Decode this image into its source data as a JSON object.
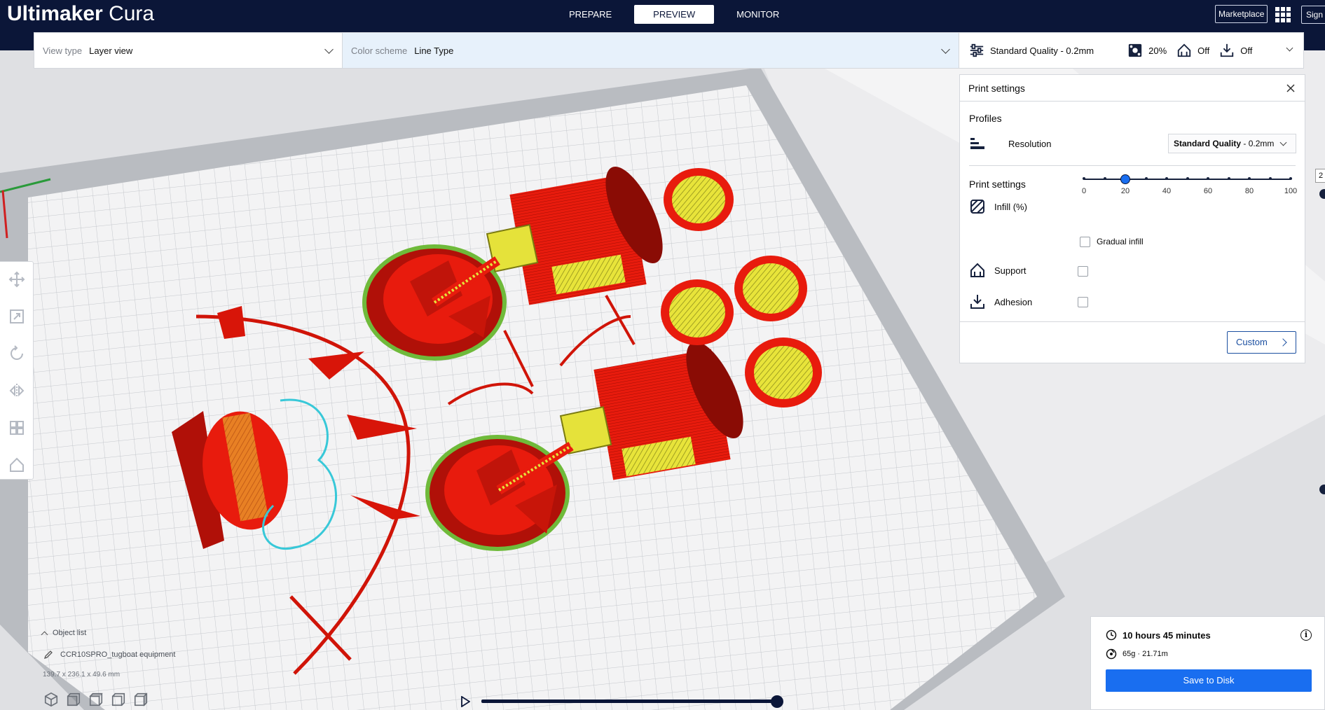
{
  "app": {
    "title_bold": "Ultimaker",
    "title_light": "Cura"
  },
  "stages": [
    "PREPARE",
    "PREVIEW",
    "MONITOR"
  ],
  "header": {
    "marketplace": "Marketplace",
    "signin": "Sign in"
  },
  "view_controls": {
    "view_type_label": "View type",
    "view_type_value": "Layer view",
    "color_scheme_label": "Color scheme",
    "color_scheme_value": "Line Type"
  },
  "print_bar": {
    "profile": "Standard Quality - 0.2mm",
    "infill": "20%",
    "support": "Off",
    "adhesion": "Off"
  },
  "print_panel": {
    "title": "Print settings",
    "profiles_title": "Profiles",
    "resolution_label": "Resolution",
    "resolution_value_bold": "Standard Quality",
    "resolution_value_rest": " - 0.2mm",
    "settings_title": "Print settings",
    "infill_label": "Infill (%)",
    "infill_value": 20,
    "infill_ticks": [
      "0",
      "20",
      "40",
      "60",
      "80",
      "100"
    ],
    "gradual_infill": "Gradual infill",
    "support_label": "Support",
    "adhesion_label": "Adhesion",
    "custom_button": "Custom"
  },
  "edge_value": "2",
  "object_list": {
    "title": "Object list",
    "object_name": "CCR10SPRO_tugboat equipment",
    "dimensions": "139.7 x 236.1 x 49.6 mm"
  },
  "estimate": {
    "time": "10 hours 45 minutes",
    "material": "65g · 21.71m",
    "save_button": "Save to Disk"
  },
  "colors": {
    "accent": "#196ef0",
    "header_bg": "#0b1638",
    "wall": "#e31b0c",
    "infill": "#e5e53a",
    "skin": "#79c33c",
    "travel": "#2ec4d3"
  }
}
